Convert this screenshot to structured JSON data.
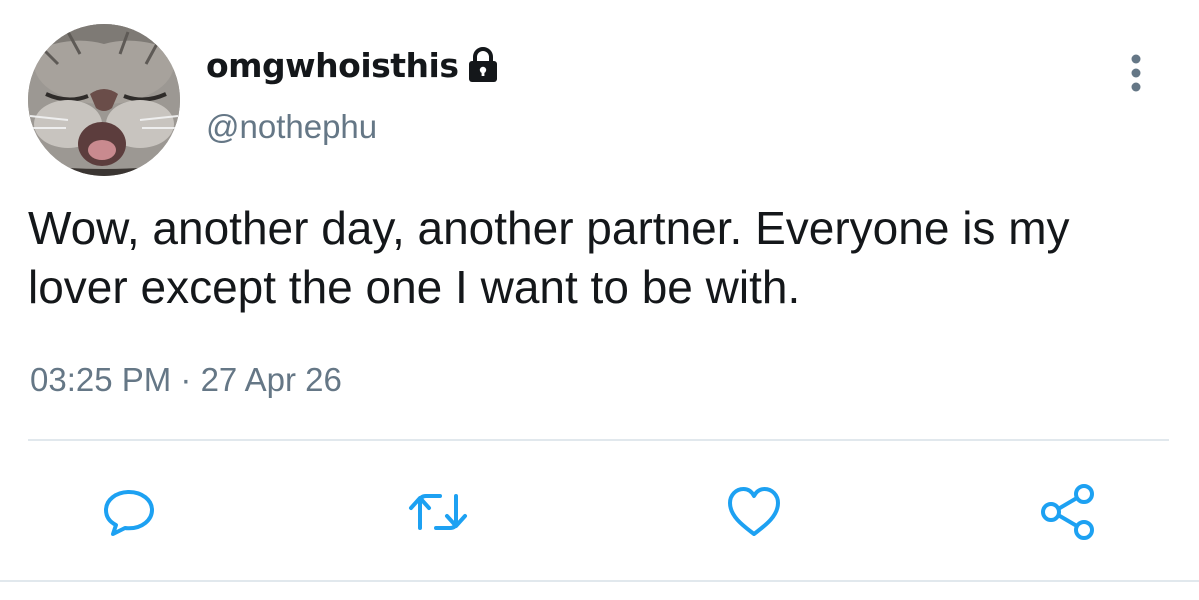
{
  "author": {
    "display_name": "omgwhoisthis",
    "handle": "@nothephu",
    "protected": true,
    "avatar_icon": "cat-face-avatar"
  },
  "tweet": {
    "text": "Wow, another day, another partner. Everyone is my lover except the one I want to be with.",
    "timestamp": "03:25 PM · 27 Apr 26"
  },
  "actions": [
    {
      "icon": "reply-icon"
    },
    {
      "icon": "retweet-icon"
    },
    {
      "icon": "heart-icon"
    },
    {
      "icon": "share-icon"
    }
  ],
  "colors": {
    "text_primary": "#14171a",
    "text_secondary": "#657786",
    "icon_action": "#1da1f2",
    "divider": "#e1e8ed"
  }
}
